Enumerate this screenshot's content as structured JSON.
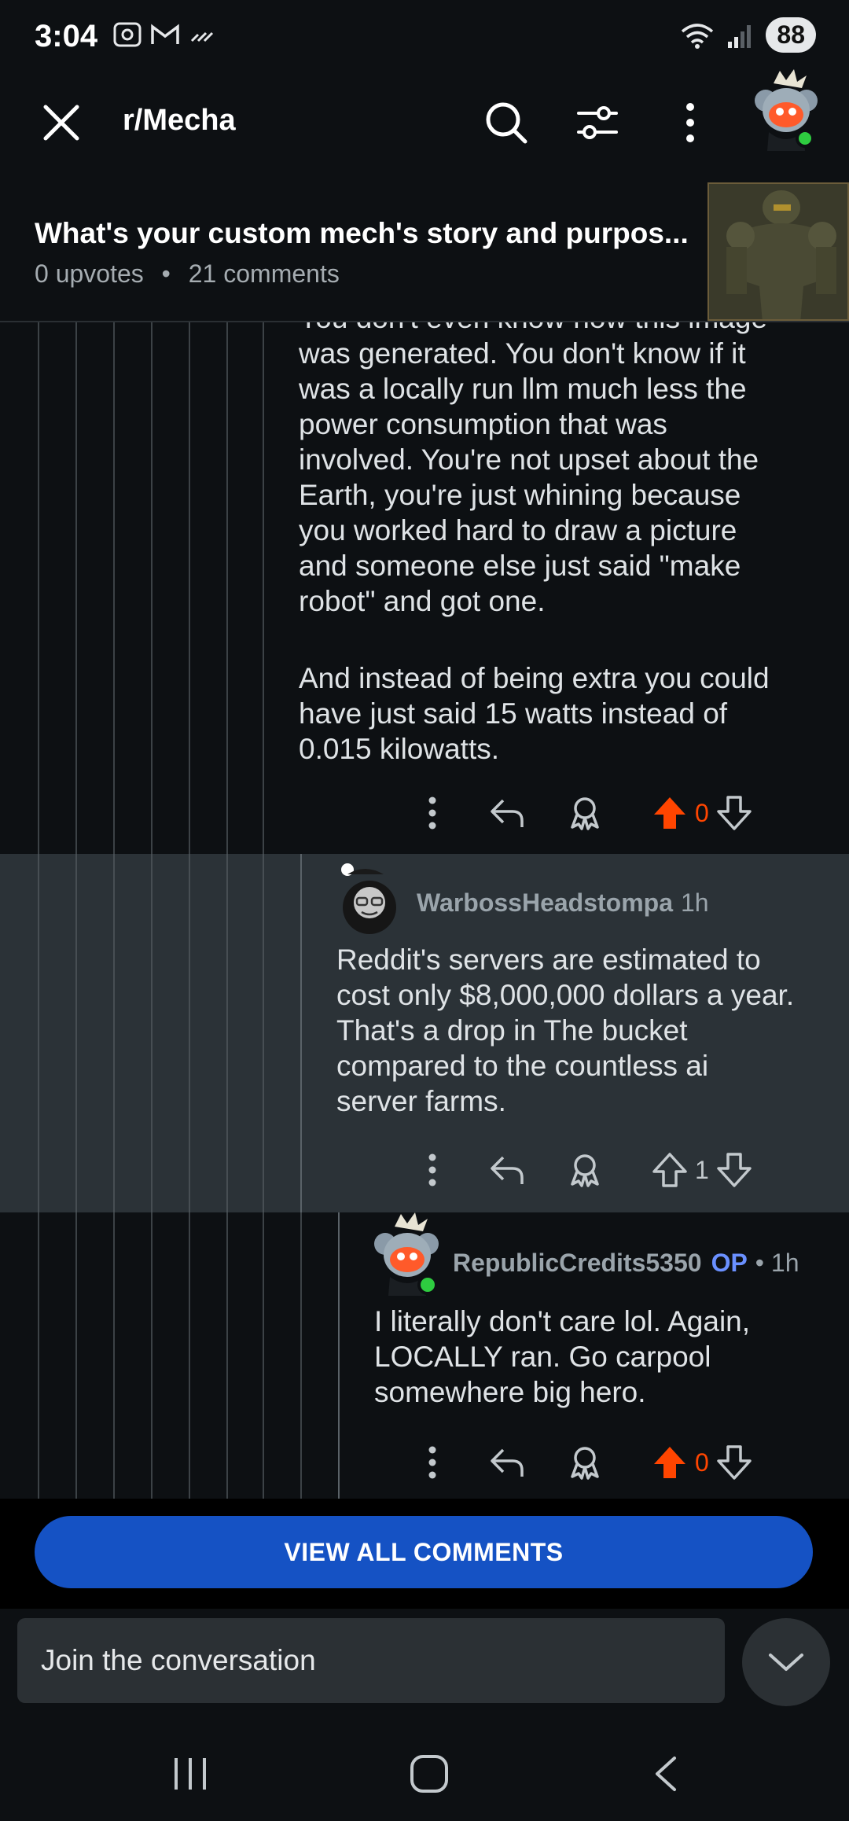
{
  "status_bar": {
    "time": "3:04",
    "battery": "88",
    "wifi_label": "6"
  },
  "top_bar": {
    "subreddit": "r/Mecha"
  },
  "post": {
    "title": "What's your custom mech's story and purpos...",
    "upvotes": "0 upvotes",
    "separator": "•",
    "comments": "21 comments"
  },
  "comments": [
    {
      "partial_top": "You don't even know how this image",
      "text_lines": [
        "was generated. You don't know if it",
        "was a locally run llm much less the",
        "power consumption that was",
        "involved. You're not upset about the",
        "Earth, you're just whining because",
        "you worked hard to draw a picture",
        "and someone else just said \"make",
        "robot\" and got one."
      ],
      "text_lines_2": [
        "And instead of being extra you could",
        "have just said 15 watts instead of",
        "0.015 kilowatts."
      ],
      "votes": "0",
      "upvoted": true
    },
    {
      "author": "WarbossHeadstompa",
      "time": "1h",
      "text_lines": [
        "Reddit's servers are estimated to",
        "cost only $8,000,000 dollars a year.",
        "That's a drop in The bucket",
        "compared to the countless ai",
        "server farms."
      ],
      "votes": "1",
      "upvoted": false
    },
    {
      "author": "RepublicCredits5350",
      "op_label": "OP",
      "time": "• 1h",
      "text_lines": [
        "I literally don't care lol. Again,",
        "LOCALLY ran. Go carpool",
        "somewhere big hero."
      ],
      "votes": "0",
      "upvoted": true
    }
  ],
  "view_all_label": "VIEW ALL COMMENTS",
  "compose": {
    "placeholder": "Join the conversation"
  },
  "colors": {
    "upvote_active": "#ff4500",
    "view_all_bg": "#1552c4",
    "highlight_bg": "#2b3237",
    "op": "#6a90ff",
    "online": "#2ecc40"
  },
  "icons": {
    "close": "close-icon",
    "search": "search-icon",
    "filter": "filter-icon",
    "more": "more-vertical-icon",
    "reply": "reply-icon",
    "award": "award-icon",
    "upvote": "upvote-icon",
    "downvote": "downvote-icon"
  }
}
